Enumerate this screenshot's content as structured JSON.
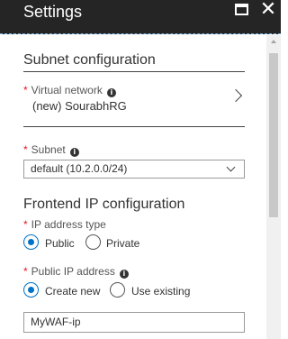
{
  "window": {
    "title": "Settings"
  },
  "subnet_config": {
    "header": "Subnet configuration",
    "virtual_network": {
      "required_mark": "*",
      "label": "Virtual network",
      "value": "(new) SourabhRG"
    },
    "subnet": {
      "required_mark": "*",
      "label": "Subnet",
      "selected": "default (10.2.0.0/24)"
    }
  },
  "frontend_ip": {
    "header": "Frontend IP configuration",
    "ip_type": {
      "required_mark": "*",
      "label": "IP address type",
      "options": [
        {
          "label": "Public",
          "checked": true
        },
        {
          "label": "Private",
          "checked": false
        }
      ]
    },
    "public_ip": {
      "required_mark": "*",
      "label": "Public IP address",
      "options": [
        {
          "label": "Create new",
          "checked": true
        },
        {
          "label": "Use existing",
          "checked": false
        }
      ],
      "name_value": "MyWAF-ip"
    }
  },
  "icons": {
    "info": "info-icon",
    "maximize": "maximize-icon",
    "close": "close-icon",
    "chevron_right": "chevron-right-icon",
    "chevron_down": "chevron-down-icon"
  },
  "colors": {
    "accent": "#0072c6",
    "required": "#e81123",
    "titlebar": "#252525"
  }
}
